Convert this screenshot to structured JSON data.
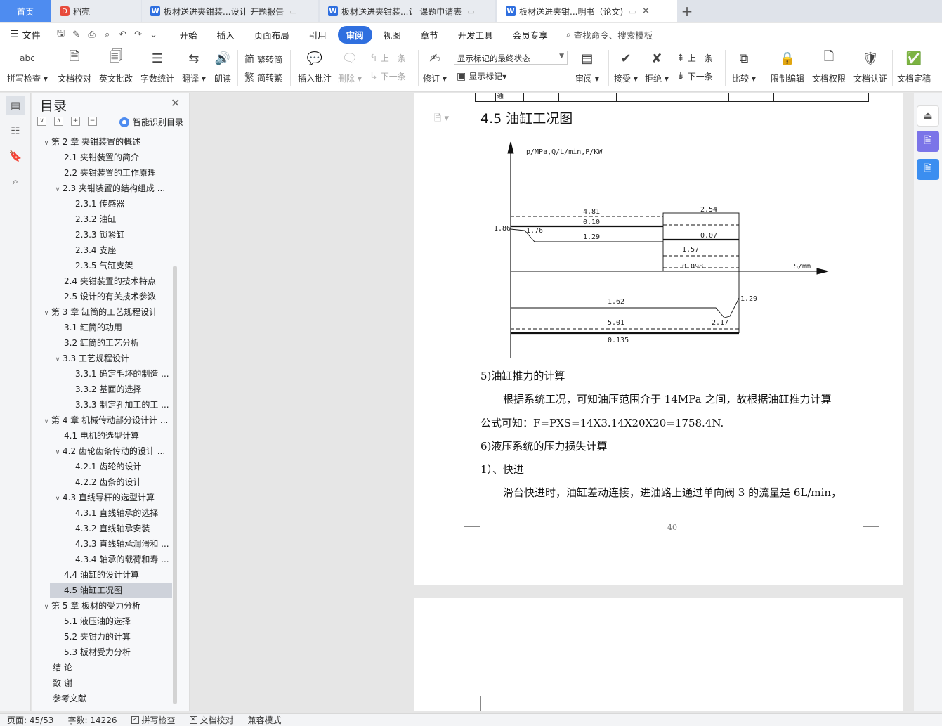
{
  "tabs": {
    "home": "首页",
    "daoke": "稻壳",
    "doc1": "板材送进夹钳装...设计 开题报告",
    "doc2": "板材送进夹钳装...计 课题申请表",
    "doc3": "板材送进夹钳...明书（论文)"
  },
  "menu": {
    "file": "文件",
    "tabs": [
      "开始",
      "插入",
      "页面布局",
      "引用",
      "审阅",
      "视图",
      "章节",
      "开发工具",
      "会员专享"
    ],
    "active_tab": "审阅",
    "search_placeholder": "查找命令、搜索模板"
  },
  "ribbon": {
    "spell_check": "拼写检查",
    "doc_proof": "文档校对",
    "en_review": "英文批改",
    "word_count": "字数统计",
    "translate": "翻译",
    "read_aloud": "朗读",
    "trad_to_simp": "繁转简",
    "simp_to_trad": "简转繁",
    "insert_comment": "插入批注",
    "delete": "删除",
    "prev_item": "上一条",
    "next_item": "下一条",
    "track_changes": "修订",
    "markup_state": "显示标记的最终状态",
    "show_markup": "显示标记",
    "review_pane": "审阅",
    "accept": "接受",
    "reject": "拒绝",
    "prev_change": "上一条",
    "next_change": "下一条",
    "compare": "比较",
    "restrict_edit": "限制编辑",
    "doc_permission": "文档权限",
    "doc_certify": "文档认证",
    "doc_finalize": "文档定稿"
  },
  "toc": {
    "title": "目录",
    "smart": "智能识别目录",
    "items": [
      {
        "level": "l1",
        "tw": "∨",
        "text": "第 2 章  夹钳装置的概述"
      },
      {
        "level": "l2n",
        "tw": "",
        "text": "2.1  夹钳装置的简介"
      },
      {
        "level": "l2n",
        "tw": "",
        "text": "2.2  夹钳装置的工作原理"
      },
      {
        "level": "l2",
        "tw": "∨",
        "text": "2.3  夹钳装置的结构组成 ..."
      },
      {
        "level": "l3",
        "tw": "",
        "text": "2.3.1 传感器"
      },
      {
        "level": "l3",
        "tw": "",
        "text": "2.3.2  油缸"
      },
      {
        "level": "l3",
        "tw": "",
        "text": "2.3.3  锁紧缸"
      },
      {
        "level": "l3",
        "tw": "",
        "text": "2.3.4  支座"
      },
      {
        "level": "l3",
        "tw": "",
        "text": "2.3.5  气缸支架"
      },
      {
        "level": "l2n",
        "tw": "",
        "text": "2.4  夹钳装置的技术特点"
      },
      {
        "level": "l2n",
        "tw": "",
        "text": "2.5  设计的有关技术参数"
      },
      {
        "level": "l1",
        "tw": "∨",
        "text": "第 3 章  缸筒的工艺规程设计"
      },
      {
        "level": "l2n",
        "tw": "",
        "text": "3.1  缸筒的功用"
      },
      {
        "level": "l2n",
        "tw": "",
        "text": "3.2  缸筒的工艺分析"
      },
      {
        "level": "l2",
        "tw": "∨",
        "text": "3.3  工艺规程设计"
      },
      {
        "level": "l3",
        "tw": "",
        "text": "3.3.1  确定毛坯的制造 ..."
      },
      {
        "level": "l3",
        "tw": "",
        "text": "3.3.2  基面的选择"
      },
      {
        "level": "l3",
        "tw": "",
        "text": "3.3.3  制定孔加工的工 ..."
      },
      {
        "level": "l1",
        "tw": "∨",
        "text": "第 4 章  机械传动部分设计计 ..."
      },
      {
        "level": "l2n",
        "tw": "",
        "text": "4.1 电机的选型计算"
      },
      {
        "level": "l2",
        "tw": "∨",
        "text": "4.2 齿轮齿条传动的设计 ..."
      },
      {
        "level": "l3",
        "tw": "",
        "text": "4.2.1 齿轮的设计"
      },
      {
        "level": "l3",
        "tw": "",
        "text": "4.2.2 齿条的设计"
      },
      {
        "level": "l2",
        "tw": "∨",
        "text": "4.3 直线导杆的选型计算"
      },
      {
        "level": "l3",
        "tw": "",
        "text": "4.3.1 直线轴承的选择"
      },
      {
        "level": "l3",
        "tw": "",
        "text": "4.3.2 直线轴承安装"
      },
      {
        "level": "l3",
        "tw": "",
        "text": "4.3.3 直线轴承润滑和 ..."
      },
      {
        "level": "l3",
        "tw": "",
        "text": "4.3.4 轴承的载荷和寿 ..."
      },
      {
        "level": "l2n",
        "tw": "",
        "text": "4.4 油缸的设计计算"
      },
      {
        "level": "sel",
        "tw": "",
        "text": "4.5 油缸工况图"
      },
      {
        "level": "l1",
        "tw": "∨",
        "text": "第 5 章  板材的受力分析"
      },
      {
        "level": "l2n",
        "tw": "",
        "text": "5.1  液压油的选择"
      },
      {
        "level": "l2n",
        "tw": "",
        "text": "5.2  夹钳力的计算"
      },
      {
        "level": "l2n",
        "tw": "",
        "text": "5.3  板材受力分析"
      },
      {
        "level": "end",
        "tw": "",
        "text": "结    论"
      },
      {
        "level": "end",
        "tw": "",
        "text": "致    谢"
      },
      {
        "level": "end",
        "tw": "",
        "text": "参考文献"
      }
    ]
  },
  "document": {
    "table_fragment": "通",
    "heading": "4.5 油缸工况图",
    "chart": {
      "axis_label": "p/MPa,Q/L/min,P/KW",
      "x_axis_label": "S/mm",
      "labels": {
        "a481": "4.81",
        "a010": "0.10",
        "a186": "1.86",
        "a176": "1.76",
        "a129": "1.29",
        "b254": "2.54",
        "b007": "0.07",
        "b157": "1.57",
        "b0098": "0.098",
        "c162": "1.62",
        "c129": "1.29",
        "c501": "5.01",
        "c217": "2.17",
        "c0135": "0.135"
      }
    },
    "p1": "5)油缸推力的计算",
    "p2": "根据系统工况，可知油压范围介于 14MPa 之间，故根据油缸推力计算",
    "p3": "公式可知：F=PXS=14X3.14X20X20=1758.4N.",
    "p4": "6)液压系统的压力损失计算",
    "p5": "1）、快进",
    "p6": "滑台快进时，油缸差动连接，进油路上通过单向阀 3 的流量是 6L/min，",
    "page_number": "40"
  },
  "status": {
    "page": "页面: 45/53",
    "words": "字数: 14226",
    "spell": "拼写检查",
    "proof": "文档校对",
    "compat": "兼容模式"
  }
}
